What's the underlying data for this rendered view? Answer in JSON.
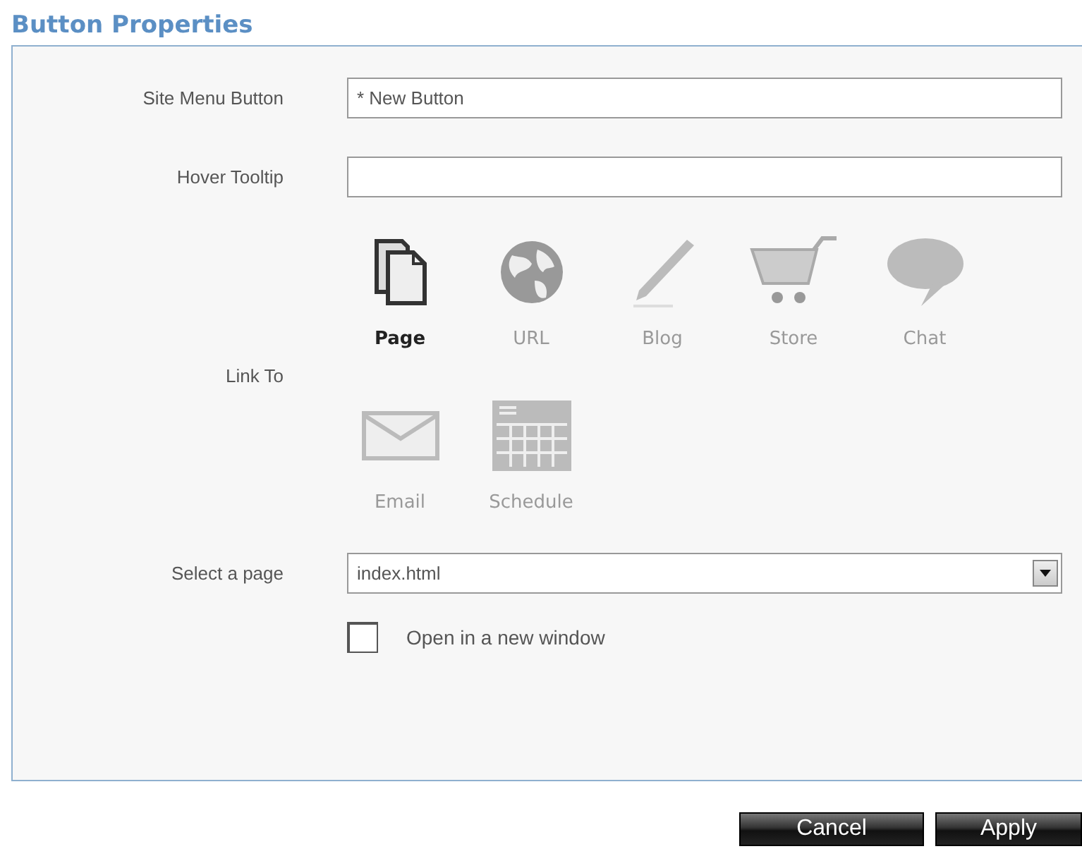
{
  "title": "Button Properties",
  "fields": [
    {
      "label": "Site Menu Button",
      "value": "* New Button"
    },
    {
      "label": "Hover Tooltip"
    }
  ],
  "link_to": {
    "label": "Link To",
    "options": [
      {
        "kind": "page",
        "label": "Page",
        "selected": true
      },
      {
        "kind": "url",
        "label": "URL",
        "selected": false
      },
      {
        "kind": "blog",
        "label": "Blog",
        "selected": false
      },
      {
        "kind": "store",
        "label": "Store",
        "selected": false
      },
      {
        "kind": "chat",
        "label": "Chat",
        "selected": false
      },
      {
        "kind": "email",
        "label": "Email",
        "selected": false
      },
      {
        "kind": "schedule",
        "label": "Schedule",
        "selected": false
      }
    ]
  },
  "select_page": {
    "label": "Select a page",
    "value": "index.html"
  },
  "new_window": {
    "label": "Open in a new window",
    "checked": false
  },
  "buttons": [
    "Cancel",
    "Apply"
  ]
}
